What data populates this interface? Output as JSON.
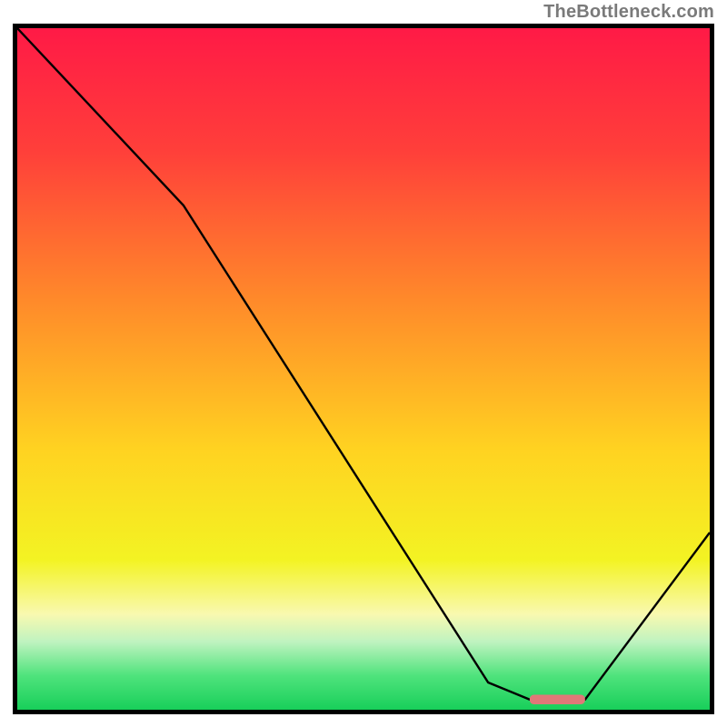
{
  "attribution": "TheBottleneck.com",
  "chart_data": {
    "type": "line",
    "title": "",
    "xlabel": "",
    "ylabel": "",
    "xlim": [
      0,
      100
    ],
    "ylim": [
      0,
      100
    ],
    "gradient": {
      "stops": [
        {
          "offset": 0.0,
          "color": "#ff1a46"
        },
        {
          "offset": 0.18,
          "color": "#ff3f3a"
        },
        {
          "offset": 0.4,
          "color": "#ff8a2a"
        },
        {
          "offset": 0.62,
          "color": "#ffd321"
        },
        {
          "offset": 0.78,
          "color": "#f3f323"
        },
        {
          "offset": 0.86,
          "color": "#f9f9b0"
        },
        {
          "offset": 0.9,
          "color": "#bff3c0"
        },
        {
          "offset": 0.95,
          "color": "#4fe37c"
        },
        {
          "offset": 1.0,
          "color": "#18cf5a"
        }
      ]
    },
    "series": [
      {
        "name": "bottleneck-curve",
        "x": [
          0,
          24,
          68,
          74,
          82,
          100
        ],
        "values": [
          100,
          74,
          4,
          1.5,
          1.5,
          26
        ]
      }
    ],
    "marker": {
      "name": "optimal-range-marker",
      "x0": 74,
      "x1": 82,
      "y": 1.5,
      "color": "#e07878"
    }
  }
}
